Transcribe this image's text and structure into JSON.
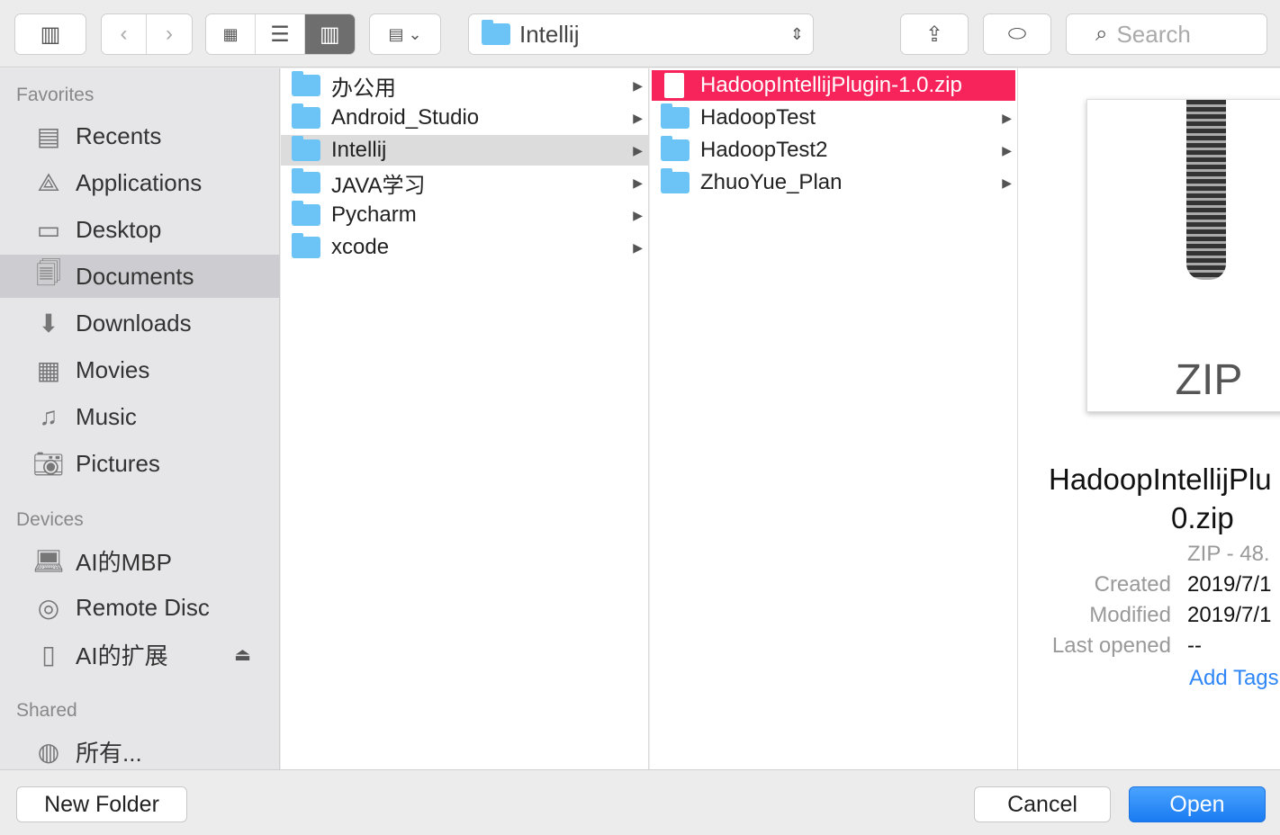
{
  "toolbar": {
    "path": "Intellij",
    "search_placeholder": "Search"
  },
  "sidebar": {
    "favorites_label": "Favorites",
    "favorites": [
      {
        "label": "Recents",
        "icon": "recents-icon"
      },
      {
        "label": "Applications",
        "icon": "applications-icon"
      },
      {
        "label": "Desktop",
        "icon": "desktop-icon"
      },
      {
        "label": "Documents",
        "icon": "documents-icon",
        "selected": true
      },
      {
        "label": "Downloads",
        "icon": "downloads-icon"
      },
      {
        "label": "Movies",
        "icon": "movies-icon"
      },
      {
        "label": "Music",
        "icon": "music-icon"
      },
      {
        "label": "Pictures",
        "icon": "pictures-icon"
      }
    ],
    "devices_label": "Devices",
    "devices": [
      {
        "label": "AI的MBP",
        "icon": "laptop-icon"
      },
      {
        "label": "Remote Disc",
        "icon": "disc-icon"
      },
      {
        "label": "AI的扩展",
        "icon": "drive-icon"
      }
    ],
    "shared_label": "Shared",
    "shared": [
      {
        "label": "所有...",
        "icon": "network-icon"
      }
    ]
  },
  "column1": [
    {
      "label": "办公用"
    },
    {
      "label": "Android_Studio"
    },
    {
      "label": "Intellij",
      "selected": true
    },
    {
      "label": "JAVA学习"
    },
    {
      "label": "Pycharm"
    },
    {
      "label": "xcode"
    }
  ],
  "column2": [
    {
      "label": "HadoopIntellijPlugin-1.0.zip",
      "type": "file",
      "highlighted": true
    },
    {
      "label": "HadoopTest",
      "type": "folder"
    },
    {
      "label": "HadoopTest2",
      "type": "folder"
    },
    {
      "label": "ZhuoYue_Plan",
      "type": "folder"
    }
  ],
  "preview": {
    "icon_text": "ZIP",
    "name_line1": "HadoopIntellijPlu",
    "name_line2": "0.zip",
    "kind": "ZIP - 48.",
    "created_label": "Created",
    "created": "2019/7/1",
    "modified_label": "Modified",
    "modified": "2019/7/1",
    "last_opened_label": "Last opened",
    "last_opened": "--",
    "add_tags": "Add Tags"
  },
  "buttons": {
    "new_folder": "New Folder",
    "cancel": "Cancel",
    "open": "Open"
  },
  "colors": {
    "highlight": "#f7245c",
    "accent": "#1a7bf2"
  }
}
